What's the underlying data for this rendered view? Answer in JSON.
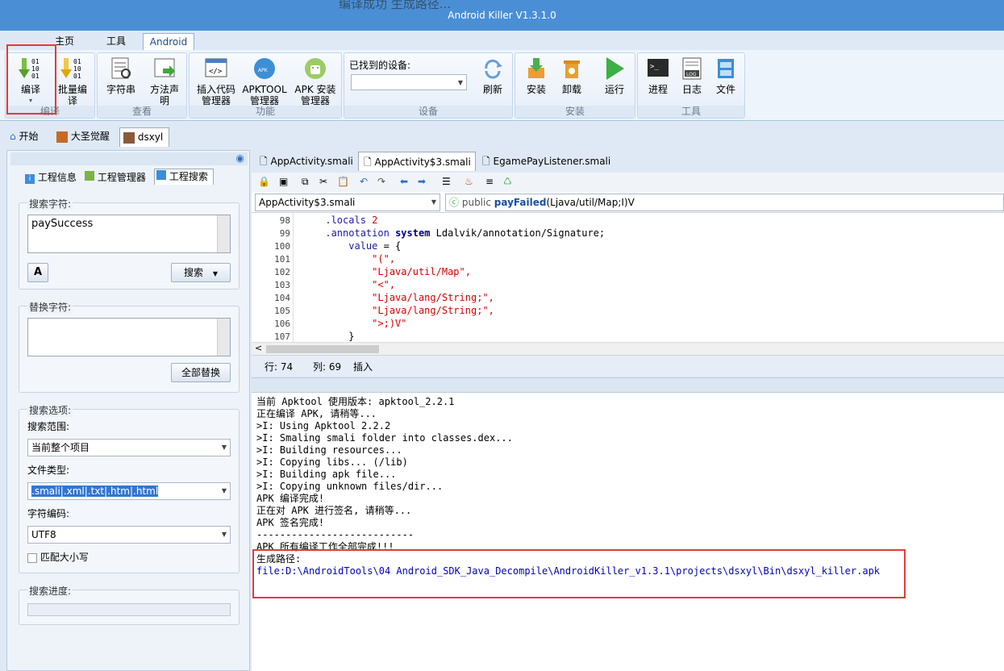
{
  "window": {
    "title": "Android Killer V1.3.1.0",
    "blurred_text": "编译成功  生成路径..."
  },
  "ribbon_tabs": [
    "主页",
    "工具",
    "Android"
  ],
  "ribbon": {
    "compile": {
      "label": "编译",
      "group": "编译"
    },
    "batch_compile": {
      "label_line1": "批量编",
      "label_line2": "译"
    },
    "strings": {
      "label": "字符串"
    },
    "method_decl": {
      "label_line1": "方法声",
      "label_line2": "明"
    },
    "view_group": "查看",
    "insert_code": {
      "label_line1": "插入代码",
      "label_line2": "管理器"
    },
    "apktool": {
      "label_line1": "APKTOOL",
      "label_line2": "管理器"
    },
    "apk_install": {
      "label_line1": "APK 安装",
      "label_line2": "管理器"
    },
    "function_group": "功能",
    "device": {
      "label": "已找到的设备:",
      "refresh": "刷新",
      "group": "设备"
    },
    "install": {
      "install": "安装",
      "uninstall": "卸载",
      "group": "安装"
    },
    "run": "运行",
    "tools": {
      "process": "进程",
      "log": "日志",
      "file": "文件",
      "group": "工具"
    }
  },
  "doc_tabs": [
    "开始",
    "大圣觉醒",
    "dsxyl"
  ],
  "left_panel": {
    "tabs": [
      "工程信息",
      "工程管理器",
      "工程搜索"
    ],
    "search_label": "搜索字符:",
    "search_value": "paySuccess",
    "search_button": "搜索",
    "replace_label": "替换字符:",
    "replace_value": "",
    "replace_all_button": "全部替换",
    "options_label": "搜索选项:",
    "scope_label": "搜索范围:",
    "scope_value": "当前整个项目",
    "filetype_label": "文件类型:",
    "filetype_value": ".smali|.xml|.txt|.htm|.html",
    "encoding_label": "字符编码:",
    "encoding_value": "UTF8",
    "match_case_label": "匹配大小写",
    "match_case_checked": false,
    "progress_label": "搜索进度:",
    "progress": 0
  },
  "editor": {
    "tabs": [
      "AppActivity.smali",
      "AppActivity$3.smali",
      "EgamePayListener.smali"
    ],
    "active_tab": 1,
    "class_select": "AppActivity$3.smali",
    "method_prefix": "public ",
    "method_name": "payFailed",
    "method_sig": "(Ljava/util/Map;I)V",
    "lines": [
      {
        "n": "98",
        "t1": "    ",
        "k": ".locals",
        "rest": " ",
        "num": "2"
      },
      {
        "n": "99",
        "t1": "    ",
        "k": ".annotation",
        "k2": " system",
        "rest": " Ldalvik/annotation/Signature;"
      },
      {
        "n": "100",
        "t1": "        ",
        "k": "value",
        "rest": " = {"
      },
      {
        "n": "101",
        "t1": "            ",
        "s": "\"(\","
      },
      {
        "n": "102",
        "t1": "            ",
        "s": "\"Ljava/util/Map\","
      },
      {
        "n": "103",
        "t1": "            ",
        "s": "\"<\","
      },
      {
        "n": "104",
        "t1": "            ",
        "s": "\"Ljava/lang/String;\","
      },
      {
        "n": "105",
        "t1": "            ",
        "s": "\"Ljava/lang/String;\","
      },
      {
        "n": "106",
        "t1": "            ",
        "s": "\">;)V\""
      },
      {
        "n": "107",
        "t1": "        ",
        "rest": "}"
      }
    ],
    "status_row": "行: 74",
    "status_col": "列: 69",
    "status_mode": "插入"
  },
  "console": {
    "lines": [
      "当前 Apktool 使用版本: apktool_2.2.1",
      "正在编译 APK, 请稍等...",
      ">I: Using Apktool 2.2.2",
      ">I: Smaling smali folder into classes.dex...",
      ">I: Building resources...",
      ">I: Copying libs... (/lib)",
      ">I: Building apk file...",
      ">I: Copying unknown files/dir...",
      "APK 编译完成!",
      "正在对 APK 进行签名, 请稍等...",
      "APK 签名完成!",
      "---------------------------",
      "APK 所有编译工作全部完成!!!",
      "生成路径:"
    ],
    "output_path": "file:D:\\AndroidTools\\04 Android_SDK_Java_Decompile\\AndroidKiller_v1.3.1\\projects\\dsxyl\\Bin\\dsxyl_killer.apk"
  },
  "colors": {
    "highlight_box": "#e53935",
    "titlebar": "#4a8fd6"
  }
}
